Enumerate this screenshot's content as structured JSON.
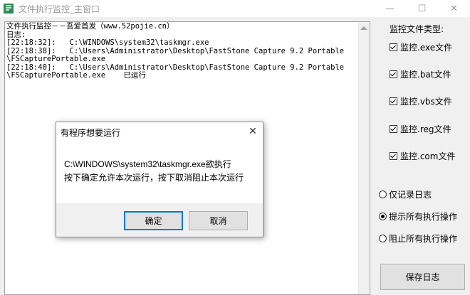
{
  "window": {
    "title": "文件执行监控_主窗口",
    "icon": "app-icon",
    "controls": {
      "minimize": "—",
      "maximize": "☐",
      "close": "✕"
    }
  },
  "log": {
    "lines": [
      "文件执行监控－－吾爱首发（www.52pojie.cn）",
      "日志:",
      "[22:18:32]:   C:\\WINDOWS\\system32\\taskmgr.exe",
      "[22:18:38]:   C:\\Users\\Administrator\\Desktop\\FastStone Capture 9.2 Portable",
      "\\FSCapturePortable.exe",
      "[22:18:40]:   C:\\Users\\Administrator\\Desktop\\FastStone Capture 9.2 Portable",
      "\\FSCapturePortable.exe    已运行"
    ]
  },
  "panel": {
    "group_label": "监控文件类型:",
    "checks": [
      {
        "label": "监控.exe文件",
        "checked": true
      },
      {
        "label": "监控.bat文件",
        "checked": true
      },
      {
        "label": "监控.vbs文件",
        "checked": true
      },
      {
        "label": "监控.reg文件",
        "checked": true
      },
      {
        "label": "监控.com文件",
        "checked": true
      }
    ],
    "radios": [
      {
        "label": "仅记录日志",
        "selected": false
      },
      {
        "label": "提示所有执行操作",
        "selected": true
      },
      {
        "label": "阻止所有执行操作",
        "selected": false
      }
    ],
    "save_label": "保存日志"
  },
  "dialog": {
    "title": "有程序想要运行",
    "close": "✕",
    "message_line1": "C:\\WINDOWS\\system32\\taskmgr.exe欲执行",
    "message_line2": "按下确定允许本次运行，按下取消阻止本次运行",
    "ok_label": "确定",
    "cancel_label": "取消"
  }
}
